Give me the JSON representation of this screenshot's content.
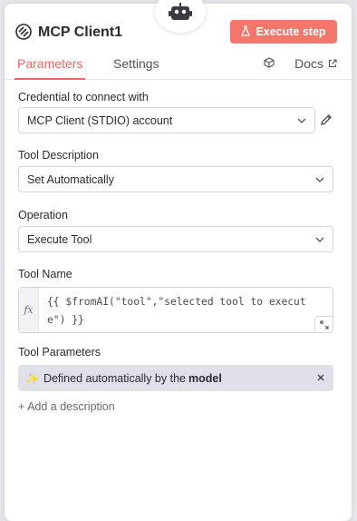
{
  "header": {
    "title": "MCP Client1",
    "execute_label": "Execute step"
  },
  "tabs": {
    "parameters": "Parameters",
    "settings": "Settings",
    "docs": "Docs"
  },
  "credential": {
    "label": "Credential to connect with",
    "value": "MCP Client (STDIO) account"
  },
  "tool_description": {
    "label": "Tool Description",
    "value": "Set Automatically"
  },
  "operation": {
    "label": "Operation",
    "value": "Execute Tool"
  },
  "tool_name": {
    "label": "Tool Name",
    "fx": "fx",
    "value": "{{ $fromAI(\"tool\",\"selected tool to execute\") }}"
  },
  "tool_parameters": {
    "label": "Tool Parameters",
    "auto_prefix": "Defined automatically by the",
    "auto_bold": "model"
  },
  "add_description": "+ Add a description",
  "colors": {
    "accent": "#ee6a5c",
    "button": "#f4776b",
    "pill": "#dfe0e8"
  },
  "icons": [
    "robot-icon",
    "node-icon",
    "flask-icon",
    "cube-icon",
    "external-link-icon",
    "chevron-down-icon",
    "pencil-icon",
    "expand-icon",
    "sparkle-icon",
    "close-icon"
  ]
}
